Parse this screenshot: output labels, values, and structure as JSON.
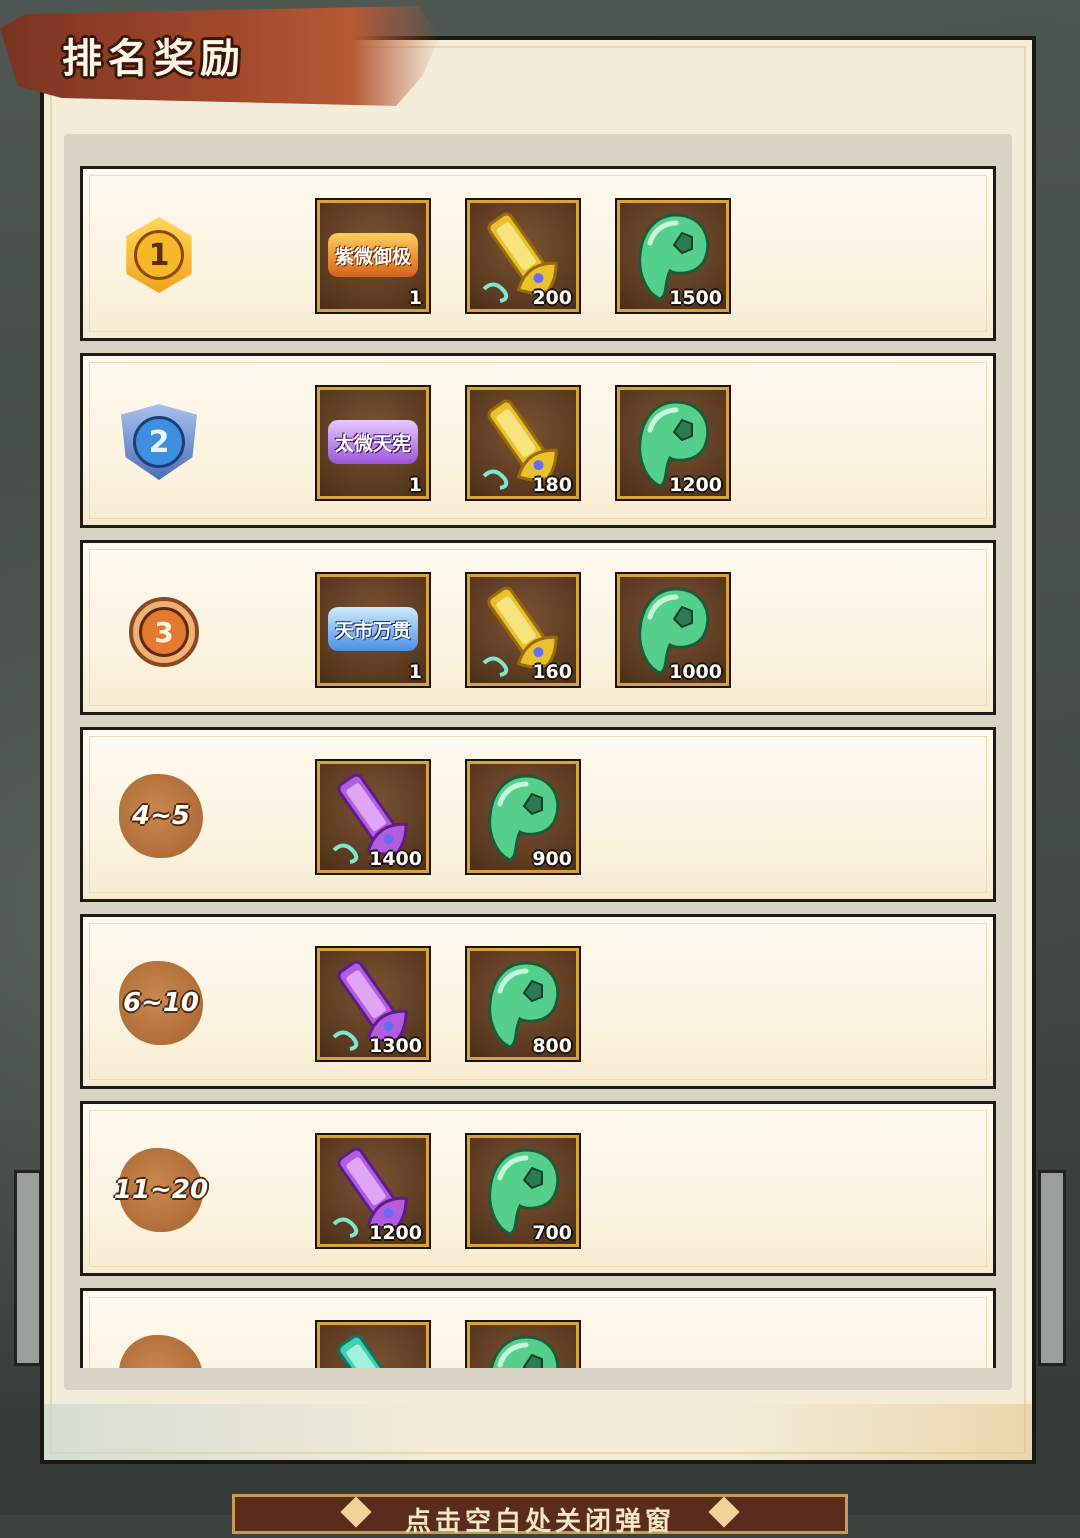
{
  "title": "排名奖励",
  "bottom_hint": "点击空白处关闭弹窗",
  "colors": {
    "panel_bg": "#f3ecd8",
    "banner": "#a44a2c",
    "item_border": "#d8a43a",
    "item_bg": "#5b3a21"
  },
  "rows": [
    {
      "rank": "1",
      "badge": "gold-medal",
      "items": [
        {
          "icon": "title-plaque-orange",
          "plaque_text": "紫微御极",
          "count": "1"
        },
        {
          "icon": "gold-command-token-icon",
          "count": "200"
        },
        {
          "icon": "green-jade-icon",
          "count": "1500"
        }
      ]
    },
    {
      "rank": "2",
      "badge": "silver-shield",
      "items": [
        {
          "icon": "title-plaque-purple",
          "plaque_text": "太微天宪",
          "count": "1"
        },
        {
          "icon": "gold-command-token-icon",
          "count": "180"
        },
        {
          "icon": "green-jade-icon",
          "count": "1200"
        }
      ]
    },
    {
      "rank": "3",
      "badge": "bronze-medal",
      "items": [
        {
          "icon": "title-plaque-blue",
          "plaque_text": "天市万贯",
          "count": "1"
        },
        {
          "icon": "gold-command-token-icon",
          "count": "160"
        },
        {
          "icon": "green-jade-icon",
          "count": "1000"
        }
      ]
    },
    {
      "rank": "4~5",
      "badge": "cloud",
      "items": [
        {
          "icon": "purple-command-token-icon",
          "count": "1400"
        },
        {
          "icon": "green-jade-icon",
          "count": "900"
        }
      ]
    },
    {
      "rank": "6~10",
      "badge": "cloud",
      "items": [
        {
          "icon": "purple-command-token-icon",
          "count": "1300"
        },
        {
          "icon": "green-jade-icon",
          "count": "800"
        }
      ]
    },
    {
      "rank": "11~20",
      "badge": "cloud",
      "items": [
        {
          "icon": "purple-command-token-icon",
          "count": "1200"
        },
        {
          "icon": "green-jade-icon",
          "count": "700"
        }
      ]
    },
    {
      "rank": "",
      "badge": "cloud",
      "items": [
        {
          "icon": "teal-command-token-icon",
          "count": ""
        },
        {
          "icon": "green-jade-icon",
          "count": ""
        }
      ]
    }
  ]
}
